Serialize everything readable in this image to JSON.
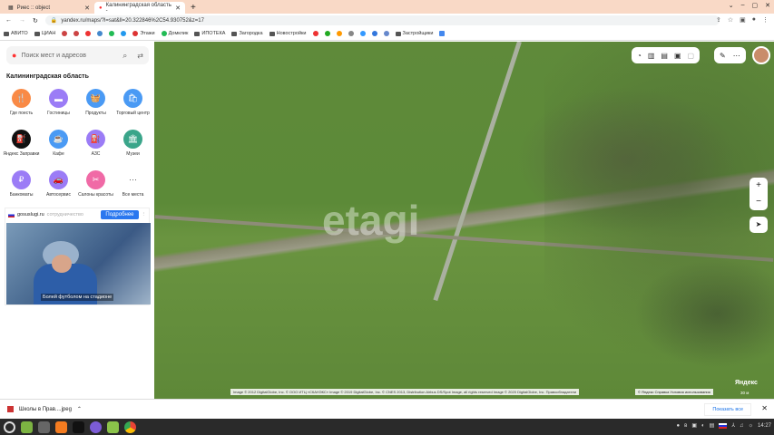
{
  "browser": {
    "tabs": [
      {
        "label": "Риес :: object",
        "active": false
      },
      {
        "label": "Калининградская область -",
        "active": true
      }
    ],
    "new_tab": "+",
    "url": "yandex.ru/maps/?l=sat&ll=20.322846%2C54.930752&z=17",
    "bookmarks": [
      "АВИТО",
      "ЦИАН",
      "Этажи",
      "Домклик",
      "ИПОТЕКА",
      "Загородка",
      "Новостройки",
      "Застройщики"
    ]
  },
  "sidebar": {
    "search_placeholder": "Поиск мест и адресов",
    "region": "Калининградская область",
    "categories": [
      {
        "label": "Где поесть",
        "color": "#f98a46",
        "glyph": "🍴"
      },
      {
        "label": "Гостиницы",
        "color": "#9b7cf6",
        "glyph": "▬"
      },
      {
        "label": "Продукты",
        "color": "#4a9af4",
        "glyph": "🧺"
      },
      {
        "label": "Торговый центр",
        "color": "#4a9af4",
        "glyph": "🛍"
      },
      {
        "label": "Яндекс Заправки",
        "color": "#111111",
        "glyph": "⛽"
      },
      {
        "label": "Кафе",
        "color": "#4a9af4",
        "glyph": "☕"
      },
      {
        "label": "АЗС",
        "color": "#9b7cf6",
        "glyph": "⛽"
      },
      {
        "label": "Музеи",
        "color": "#3aa58a",
        "glyph": "🏛"
      },
      {
        "label": "Банкоматы",
        "color": "#9b7cf6",
        "glyph": "₽"
      },
      {
        "label": "Автосервис",
        "color": "#9b7cf6",
        "glyph": "🚗"
      },
      {
        "label": "Салоны красоты",
        "color": "#f06aa6",
        "glyph": "✂"
      },
      {
        "label": "Все места",
        "color": "#ffffff",
        "glyph": "⋯"
      }
    ],
    "ad": {
      "source": "gosuslugi.ru",
      "tag": "сотрудничество",
      "button": "Подробнее",
      "caption": "Болей футболом на стадионе"
    }
  },
  "map": {
    "watermark": "etagi",
    "copyright": "Image © 2012 DigitalGlobe, Inc. © ООО ИТЦ «СКАНЭКС» Image © 2019 DigitalGlobe, Inc. © CNES 2013, Distribution Airbus DS/Spot Image, all rights reserved Image © 2020 DigitalGlobe, Inc.   Правообладатели",
    "legal": "© Яндекс  Справка  Условия использования",
    "logo": "Яндекс",
    "scale": "30 м",
    "zoom_in": "+",
    "zoom_out": "−"
  },
  "downloads": {
    "file": "Школы в Прав....jpeg",
    "show_all": "Показать все"
  },
  "taskbar": {
    "time": "14:27"
  }
}
